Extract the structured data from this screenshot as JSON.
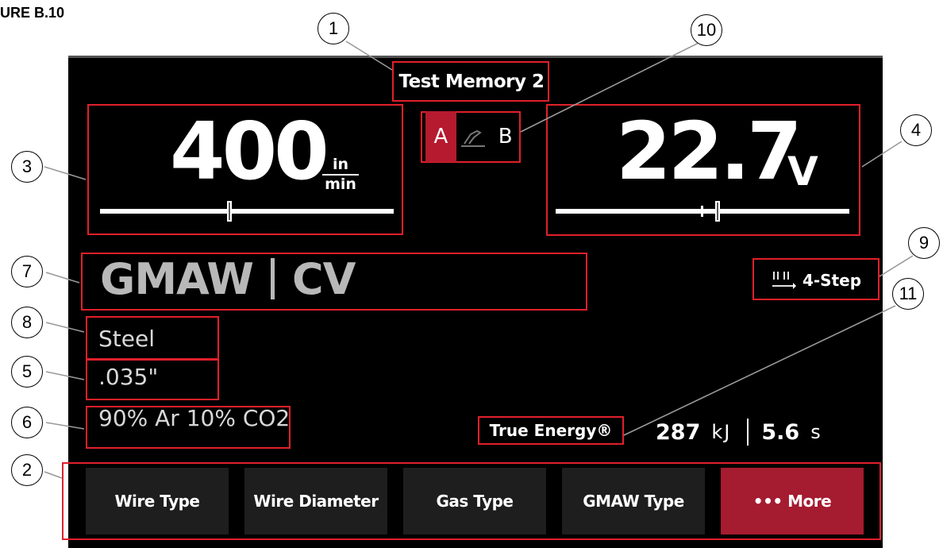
{
  "figure_label": "URE B.10",
  "memory_name": "Test Memory 2",
  "wire_feed_speed": {
    "value": "400",
    "unit_top": "in",
    "unit_bottom": "min",
    "slider_fraction": 0.44
  },
  "voltage": {
    "value": "22.7",
    "unit": "V",
    "slider_fraction": 0.55
  },
  "ab_selector": {
    "a_label": "A",
    "b_label": "B",
    "active": "A"
  },
  "process": {
    "name": "GMAW",
    "mode": "CV"
  },
  "wire_type": "Steel",
  "wire_diameter": ".035\"",
  "gas_type": "90% Ar 10% CO2",
  "trigger_mode": "4-Step",
  "true_energy": {
    "label": "True Energy®",
    "energy_value": "287",
    "energy_unit": "kJ",
    "time_value": "5.6",
    "time_unit": "s"
  },
  "softkeys": [
    "Wire Type",
    "Wire Diameter",
    "Gas Type",
    "GMAW Type",
    "••• More"
  ],
  "callouts": [
    "1",
    "2",
    "3",
    "4",
    "5",
    "6",
    "7",
    "8",
    "9",
    "10",
    "11"
  ],
  "colors": {
    "accent_red": "#a51b2f",
    "highlight_box": "#e0202a",
    "screen_bg": "#000000"
  }
}
